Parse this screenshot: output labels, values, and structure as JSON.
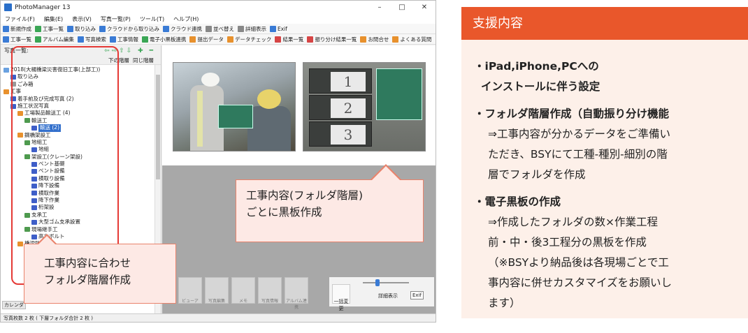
{
  "window": {
    "title": "PhotoManager 13",
    "controls": [
      "–",
      "□",
      "✕"
    ]
  },
  "menu": [
    "ファイル(F)",
    "編集(E)",
    "表示(V)",
    "写真一覧(P)",
    "ツール(T)",
    "ヘルプ(H)"
  ],
  "toolbar1": [
    {
      "label": "新規作成",
      "icon": "new-icon",
      "color": "#3a7bd5"
    },
    {
      "label": "工事一覧",
      "icon": "list-icon",
      "color": "#3aa655"
    },
    {
      "label": "取り込み",
      "icon": "import-icon",
      "color": "#3a7bd5"
    },
    {
      "label": "クラウドから取り込み",
      "icon": "cloud-icon",
      "color": "#3a7bd5"
    },
    {
      "label": "クラウド連携",
      "icon": "cloud-sync-icon",
      "color": "#3a7bd5"
    },
    {
      "label": "並べ替え",
      "icon": "sort-icon",
      "color": "#888888"
    },
    {
      "label": "詳細表示",
      "icon": "detail-icon",
      "color": "#888888"
    },
    {
      "label": "Exif",
      "icon": "exif-icon",
      "color": "#3a7bd5"
    }
  ],
  "toolbar2": [
    {
      "label": "工事一覧",
      "icon": "list-icon",
      "color": "#3a7bd5"
    },
    {
      "label": "アルバム編集",
      "icon": "album-icon",
      "color": "#3aa655"
    },
    {
      "label": "写真検索",
      "icon": "search-icon",
      "color": "#3a7bd5"
    },
    {
      "label": "工事情報",
      "icon": "info-icon",
      "color": "#3a7bd5"
    },
    {
      "label": "電子小黒板連携",
      "icon": "board-icon",
      "color": "#3aa655"
    },
    {
      "label": "提出データ",
      "icon": "submit-icon",
      "color": "#e8912d"
    },
    {
      "label": "データチェック",
      "icon": "check-icon",
      "color": "#e8912d"
    },
    {
      "label": "結果一覧",
      "icon": "result-icon",
      "color": "#d64545"
    },
    {
      "label": "振り分け結果一覧",
      "icon": "sort-result-icon",
      "color": "#d64545"
    },
    {
      "label": "お問合せ",
      "icon": "contact-icon",
      "color": "#e8912d"
    },
    {
      "label": "よくある質問",
      "icon": "faq-icon",
      "color": "#e8912d"
    }
  ],
  "left": {
    "title": "写真一覧:",
    "sub": [
      "下の階層",
      "同じ階層"
    ],
    "tree": [
      {
        "label": "2018(大槻橋梁災害復旧工事(上部工))",
        "depth": 0,
        "icon": "app"
      },
      {
        "label": "取り込み",
        "depth": 1,
        "icon": "img"
      },
      {
        "label": "ごみ箱",
        "depth": 1,
        "icon": "trash"
      },
      {
        "label": "工事",
        "depth": 0,
        "icon": "fold"
      },
      {
        "label": "着手前及び完成写真 (2)",
        "depth": 1,
        "icon": "img"
      },
      {
        "label": "施工状況写真",
        "depth": 1,
        "icon": "img"
      },
      {
        "label": "工場製品輸送工 (4)",
        "depth": 2,
        "icon": "fold"
      },
      {
        "label": "輸送工",
        "depth": 3,
        "icon": "work"
      },
      {
        "label": "輸送 (2)",
        "depth": 4,
        "icon": "img",
        "selected": true
      },
      {
        "label": "鋼橋架設工",
        "depth": 2,
        "icon": "fold"
      },
      {
        "label": "地組工",
        "depth": 3,
        "icon": "work"
      },
      {
        "label": "地組",
        "depth": 4,
        "icon": "img"
      },
      {
        "label": "架設工(クレーン架設)",
        "depth": 3,
        "icon": "work"
      },
      {
        "label": "ベント基礎",
        "depth": 4,
        "icon": "img"
      },
      {
        "label": "ベント設備",
        "depth": 4,
        "icon": "img"
      },
      {
        "label": "横取り設備",
        "depth": 4,
        "icon": "img"
      },
      {
        "label": "降下設備",
        "depth": 4,
        "icon": "img"
      },
      {
        "label": "横取作業",
        "depth": 4,
        "icon": "img"
      },
      {
        "label": "降下作業",
        "depth": 4,
        "icon": "img"
      },
      {
        "label": "桁架設",
        "depth": 4,
        "icon": "img"
      },
      {
        "label": "支承工",
        "depth": 3,
        "icon": "work"
      },
      {
        "label": "大型ゴム支承設置",
        "depth": 4,
        "icon": "img"
      },
      {
        "label": "現場継手工",
        "depth": 3,
        "icon": "work"
      },
      {
        "label": "高力ボルト",
        "depth": 4,
        "icon": "img"
      },
      {
        "label": "橋梁防護工",
        "depth": 2,
        "icon": "fold"
      }
    ],
    "calendar_tab": "カレンダ"
  },
  "tools": [
    "ビューア",
    "写真編集",
    "メモ",
    "写真情報",
    "アルバム連携"
  ],
  "right_tools": {
    "bulk": "一括変更",
    "detail": "詳細表示",
    "exif": "Exif"
  },
  "status": "写真枚数 2 枚 ( 下層フォルダ合計 2 枚 )",
  "callouts": {
    "main": [
      "工事内容(フォルダ階層)",
      "ごとに黒板作成"
    ],
    "left": [
      "工事内容に合わせ",
      "フォルダ階層作成"
    ]
  },
  "panel": {
    "header": "支援内容",
    "items": [
      {
        "title": [
          "・iPad,iPhone,PCへの",
          "インストールに伴う設定"
        ],
        "text": []
      },
      {
        "title": [
          "・フォルダ階層作成（自動振り分け機能"
        ],
        "text": [
          "⇒工事内容が分かるデータをご準備い",
          "ただき、BSYにて工種-種別-細別の階",
          "層でフォルダを作成"
        ]
      },
      {
        "title": [
          "・電子黒板の作成"
        ],
        "text": [
          "⇒作成したフォルダの数×作業工程",
          "前・中・後3工程分の黒板を作成",
          "（※BSYより納品後は各現場ごとで工",
          "事内容に併せカスタマイズをお願いし",
          "ます）"
        ]
      }
    ]
  },
  "colors": {
    "accent": "#e9572b",
    "panel_bg": "#fdf0e9",
    "callout_bg": "#fde9e5",
    "callout_border": "#e9836c",
    "outline": "#e53935",
    "selection": "#3370cc"
  }
}
